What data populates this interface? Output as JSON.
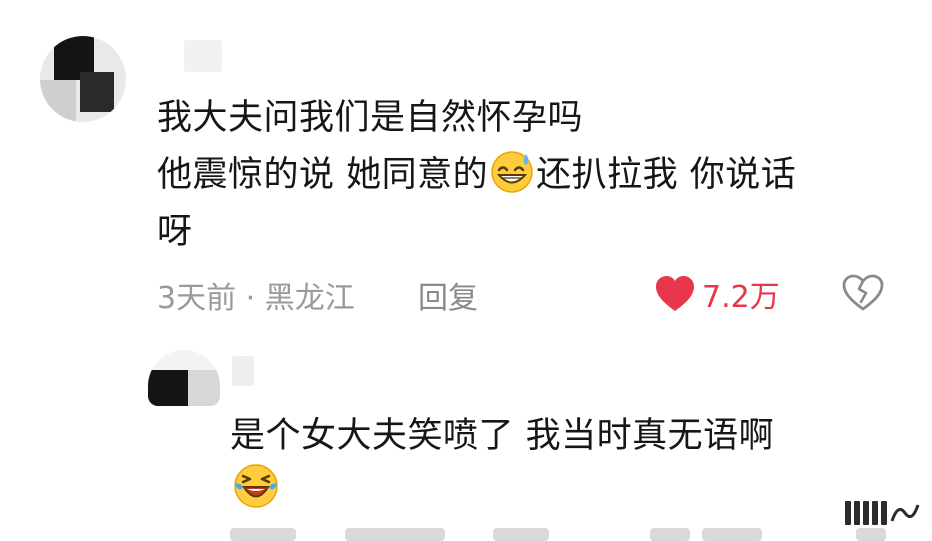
{
  "comment": {
    "lines": [
      "我大夫问我们是自然怀孕吗",
      "他震惊的说 她同意的",
      "还扒拉我  你说话",
      "呀"
    ],
    "emoji_name": "grinning-sweat-emoji",
    "time_location": "3天前 · 黑龙江",
    "reply_label": "回复",
    "like_count": "7.2万",
    "like_color": "#e8364a"
  },
  "reply": {
    "lines": [
      "是个女大夫笑喷了  我当时真无语啊"
    ],
    "emoji_name": "laughing-crying-emoji"
  }
}
